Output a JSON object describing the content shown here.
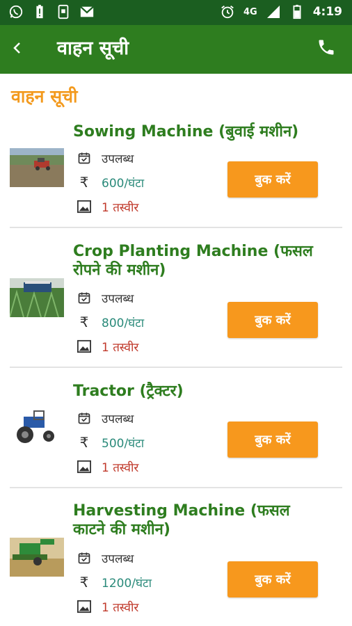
{
  "status_bar": {
    "network": "4G",
    "time": "4:19"
  },
  "header": {
    "title": "वाहन सूची"
  },
  "section_title": "वाहन सूची",
  "vehicles": [
    {
      "name": "Sowing Machine (बुवाई मशीन)",
      "availability": "उपलब्ध",
      "currency": "₹",
      "price": "600/घंटा",
      "photos": "1 तस्वीर",
      "book_label": "बुक करें"
    },
    {
      "name": "Crop Planting Machine (फसल रोपने की मशीन)",
      "availability": "उपलब्ध",
      "currency": "₹",
      "price": "800/घंटा",
      "photos": "1 तस्वीर",
      "book_label": "बुक करें"
    },
    {
      "name": "Tractor (ट्रैक्टर)",
      "availability": "उपलब्ध",
      "currency": "₹",
      "price": "500/घंटा",
      "photos": "1 तस्वीर",
      "book_label": "बुक करें"
    },
    {
      "name": "Harvesting Machine (फसल काटने की मशीन)",
      "availability": "उपलब्ध",
      "currency": "₹",
      "price": "1200/घंटा",
      "photos": "1 तस्वीर",
      "book_label": "बुक करें"
    }
  ],
  "colors": {
    "status_bar": "#1b5e20",
    "app_bar": "#2e7d1f",
    "accent_orange": "#f7981d",
    "title_green": "#2e7d1f",
    "price_teal": "#2a8a7a",
    "photo_red": "#c0392b"
  },
  "icons": [
    "whatsapp-icon",
    "battery-alert-icon",
    "phone-notification-icon",
    "gmail-icon",
    "alarm-icon",
    "signal-icon",
    "battery-icon",
    "back-arrow-icon",
    "phone-icon",
    "calendar-check-icon",
    "image-icon"
  ]
}
